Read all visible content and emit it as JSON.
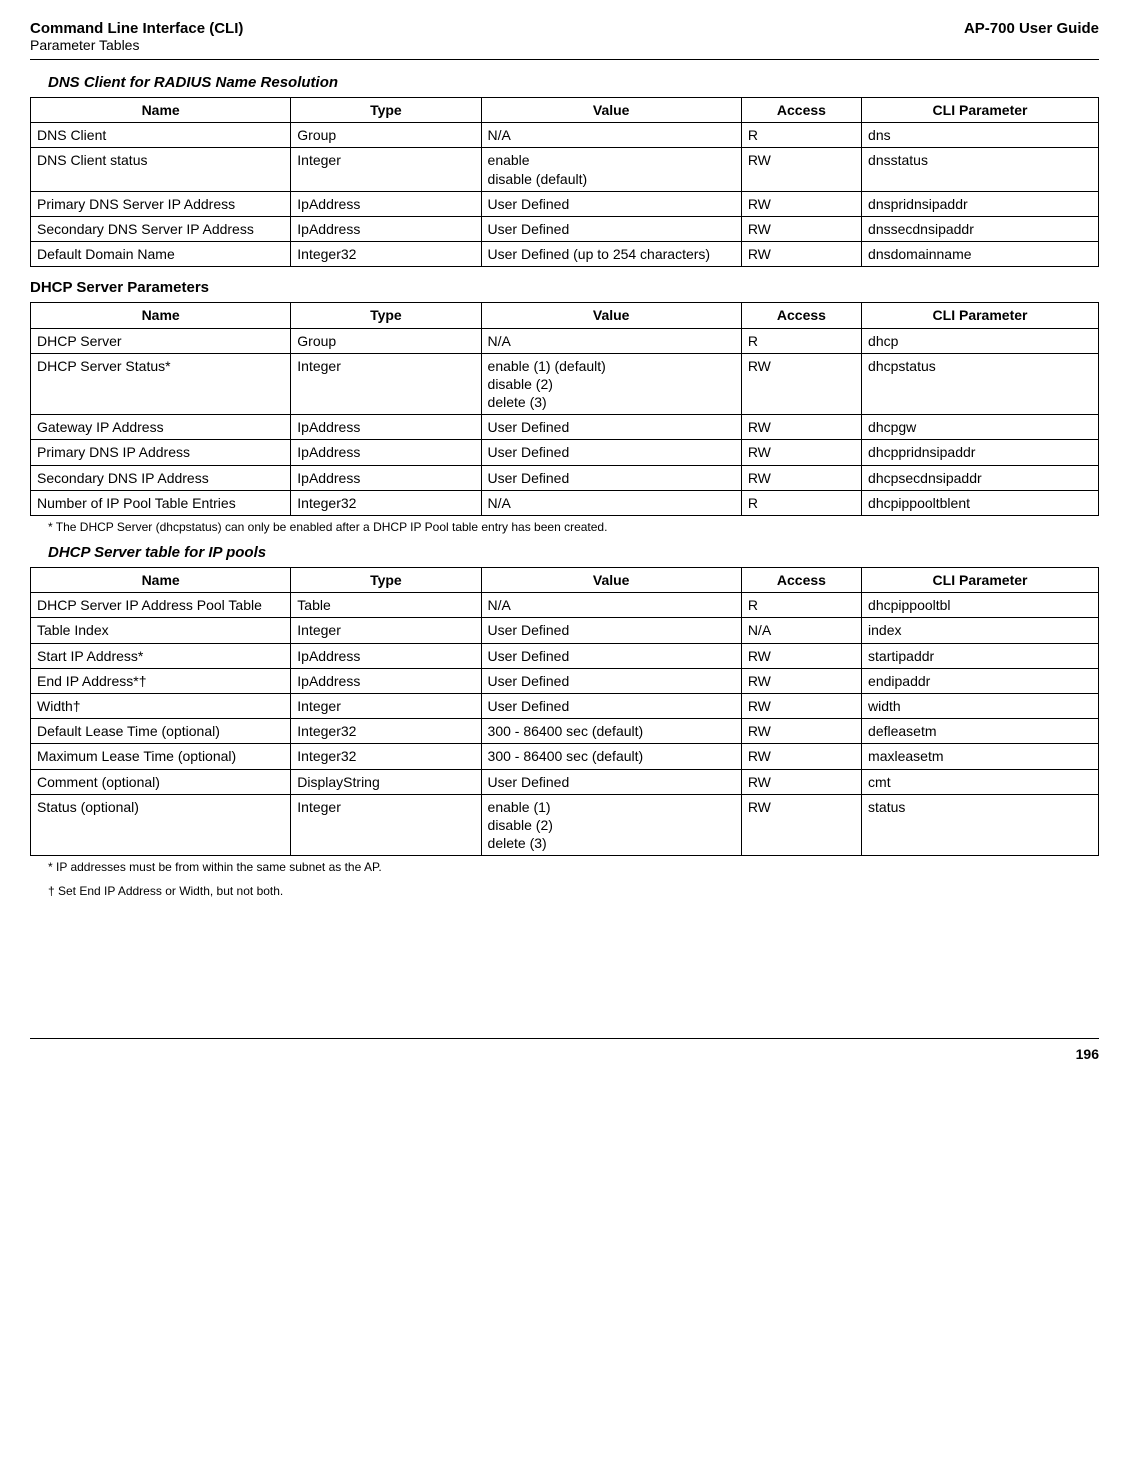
{
  "header": {
    "title_line1": "Command Line Interface (CLI)",
    "title_line2": "Parameter Tables",
    "right": "AP-700 User Guide"
  },
  "section1": {
    "title": "DNS Client for RADIUS Name Resolution",
    "headers": {
      "name": "Name",
      "type": "Type",
      "value": "Value",
      "access": "Access",
      "cli": "CLI Parameter"
    },
    "rows": [
      {
        "name": "DNS Client",
        "type": "Group",
        "value": "N/A",
        "access": "R",
        "cli": "dns"
      },
      {
        "name": "DNS Client status",
        "type": "Integer",
        "value": "enable\ndisable (default)",
        "access": "RW",
        "cli": "dnsstatus"
      },
      {
        "name": "Primary DNS Server IP Address",
        "type": "IpAddress",
        "value": "User Defined",
        "access": "RW",
        "cli": "dnspridnsipaddr"
      },
      {
        "name": "Secondary DNS Server IP Address",
        "type": "IpAddress",
        "value": "User Defined",
        "access": "RW",
        "cli": "dnssecdnsipaddr"
      },
      {
        "name": "Default Domain Name",
        "type": "Integer32",
        "value": "User Defined (up to 254 characters)",
        "access": "RW",
        "cli": "dnsdomainname"
      }
    ]
  },
  "section2": {
    "title": "DHCP Server Parameters",
    "headers": {
      "name": "Name",
      "type": "Type",
      "value": "Value",
      "access": "Access",
      "cli": "CLI Parameter"
    },
    "rows": [
      {
        "name": "DHCP Server",
        "type": "Group",
        "value": "N/A",
        "access": "R",
        "cli": "dhcp"
      },
      {
        "name": "DHCP Server Status*",
        "type": "Integer",
        "value": "enable (1) (default)\ndisable (2)\ndelete (3)",
        "access": "RW",
        "cli": "dhcpstatus"
      },
      {
        "name": "Gateway IP Address",
        "type": "IpAddress",
        "value": "User Defined",
        "access": "RW",
        "cli": "dhcpgw"
      },
      {
        "name": "Primary DNS IP Address",
        "type": "IpAddress",
        "value": "User Defined",
        "access": "RW",
        "cli": "dhcppridnsipaddr"
      },
      {
        "name": "Secondary DNS IP Address",
        "type": "IpAddress",
        "value": "User Defined",
        "access": "RW",
        "cli": "dhcpsecdnsipaddr"
      },
      {
        "name": "Number of IP Pool Table Entries",
        "type": "Integer32",
        "value": "N/A",
        "access": "R",
        "cli": "dhcpippooltblent"
      }
    ],
    "footnote": "*  The DHCP Server (dhcpstatus) can only be enabled after a DHCP IP Pool table entry has been created."
  },
  "section3": {
    "title": "DHCP Server table for IP pools",
    "headers": {
      "name": "Name",
      "type": "Type",
      "value": "Value",
      "access": "Access",
      "cli": "CLI Parameter"
    },
    "rows": [
      {
        "name": "DHCP Server IP Address Pool Table",
        "type": "Table",
        "value": "N/A",
        "access": "R",
        "cli": "dhcpippooltbl"
      },
      {
        "name": "Table Index",
        "type": "Integer",
        "value": "User Defined",
        "access": "N/A",
        "cli": "index"
      },
      {
        "name": "Start IP Address*",
        "type": "IpAddress",
        "value": "User Defined",
        "access": "RW",
        "cli": "startipaddr"
      },
      {
        "name": "End IP Address*†",
        "type": "IpAddress",
        "value": "User Defined",
        "access": "RW",
        "cli": "endipaddr"
      },
      {
        "name": "Width†",
        "type": "Integer",
        "value": "User Defined",
        "access": "RW",
        "cli": "width"
      },
      {
        "name": "Default Lease Time (optional)",
        "type": "Integer32",
        "value": "300 - 86400 sec (default)",
        "access": "RW",
        "cli": "defleasetm"
      },
      {
        "name": "Maximum Lease Time (optional)",
        "type": "Integer32",
        "value": "300 - 86400 sec (default)",
        "access": "RW",
        "cli": "maxleasetm"
      },
      {
        "name": "Comment (optional)",
        "type": "DisplayString",
        "value": "User Defined",
        "access": "RW",
        "cli": "cmt"
      },
      {
        "name": "Status (optional)",
        "type": "Integer",
        "value": "enable (1)\ndisable (2)\ndelete (3)",
        "access": "RW",
        "cli": "status"
      }
    ],
    "footnote1": "*  IP addresses must be from within the same subnet as the AP.",
    "footnote2": "†  Set End IP Address or Width, but not both."
  },
  "page_number": "196"
}
